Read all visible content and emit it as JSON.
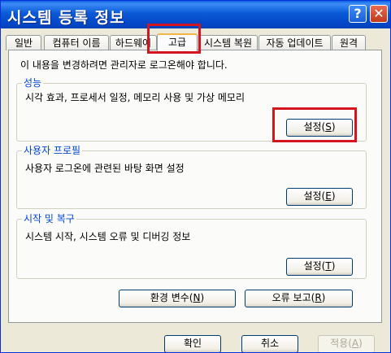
{
  "window": {
    "title": "시스템 등록 정보"
  },
  "tabs": [
    {
      "label": "일반"
    },
    {
      "label": "컴퓨터 이름"
    },
    {
      "label": "하드웨어"
    },
    {
      "label": "고급"
    },
    {
      "label": "시스템 복원"
    },
    {
      "label": "자동 업데이트"
    },
    {
      "label": "원격"
    }
  ],
  "notice": "이 내용을 변경하려면 관리자로 로그온해야 합니다.",
  "groups": {
    "performance": {
      "title": "성능",
      "desc": "시각 효과, 프로세서 일정, 메모리 사용 및 가상 메모리",
      "button_prefix": "설정(",
      "button_key": "S",
      "button_suffix": ")"
    },
    "user_profiles": {
      "title": "사용자 프로필",
      "desc": "사용자 로그온에 관련된 바탕 화면 설정",
      "button_prefix": "설정(",
      "button_key": "E",
      "button_suffix": ")"
    },
    "startup_recovery": {
      "title": "시작 및 복구",
      "desc": "시스템 시작, 시스템 오류 및 디버깅 정보",
      "button_prefix": "설정(",
      "button_key": "T",
      "button_suffix": ")"
    }
  },
  "buttons": {
    "env_prefix": "환경 변수(",
    "env_key": "N",
    "env_suffix": ")",
    "error_prefix": "오류 보고(",
    "error_key": "R",
    "error_suffix": ")",
    "ok": "확인",
    "cancel": "취소",
    "apply_prefix": "적용(",
    "apply_key": "A",
    "apply_suffix": ")"
  },
  "colors": {
    "highlight": "#d4141f",
    "title_bar": "#0a5ad6",
    "group_title": "#0046d5"
  }
}
